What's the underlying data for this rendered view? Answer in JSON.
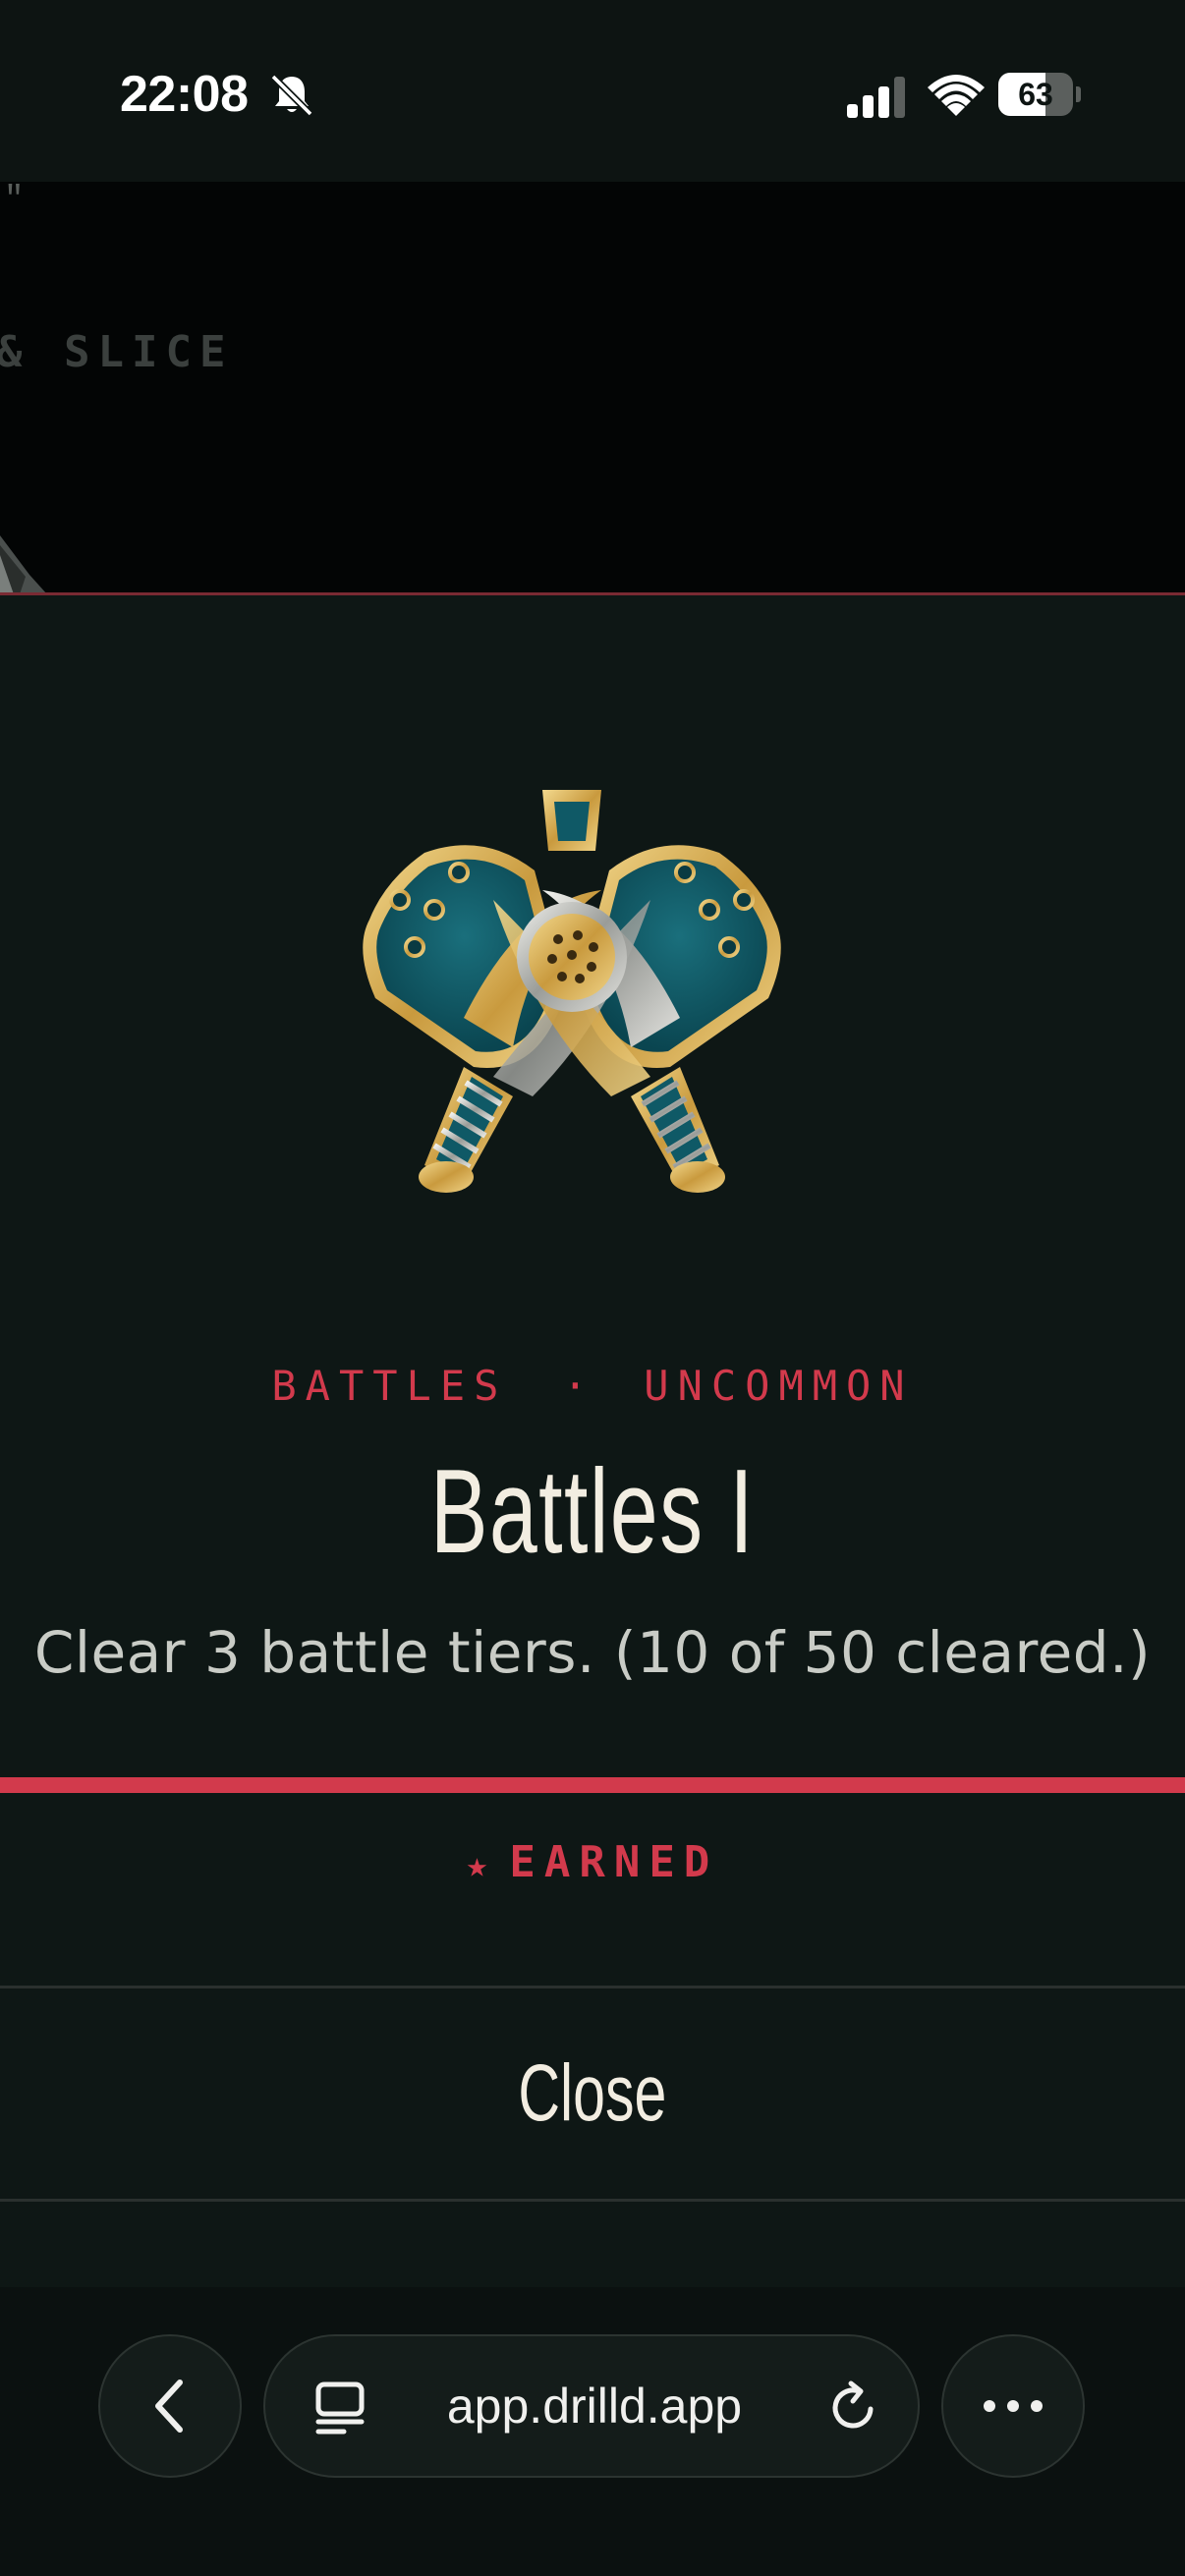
{
  "status_bar": {
    "time": "22:08",
    "battery_percent": "63",
    "battery_level": 0.63,
    "icons": [
      "bell-slash-icon",
      "cellular-signal-icon",
      "wifi-icon",
      "battery-icon"
    ]
  },
  "background_page": {
    "quote_fragment": "\"",
    "text_fragment": "& SLICE"
  },
  "achievement": {
    "badge_icon": "crossed-pickleball-paddles-badge",
    "category": "BATTLES",
    "separator": "·",
    "rarity": "UNCOMMON",
    "title": "Battles I",
    "description": "Clear 3 battle tiers. (10 of 50 cleared.)",
    "status_star": "★",
    "status": "EARNED",
    "close_label": "Close"
  },
  "browser": {
    "url": "app.drilld.app",
    "icons": [
      "back-chevron-icon",
      "tabs-icon",
      "reload-icon",
      "more-icon"
    ]
  },
  "colors": {
    "accent": "#d23a4c",
    "sheet_background": "#0e1715",
    "text_primary": "#f2ede1",
    "badge_teal": "#0f5966",
    "badge_gold": "#d9b25a"
  }
}
